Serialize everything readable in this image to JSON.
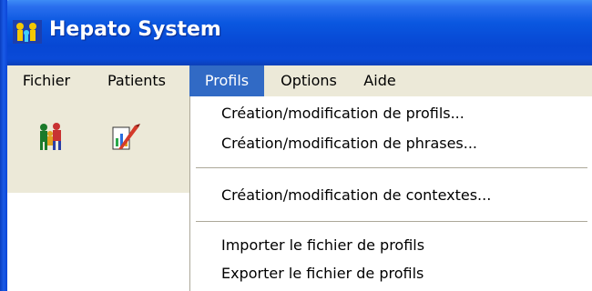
{
  "window": {
    "title": "Hepato System"
  },
  "menubar": {
    "items": [
      {
        "label": "Fichier"
      },
      {
        "label": "Patients"
      },
      {
        "label": "Profils"
      },
      {
        "label": "Options"
      },
      {
        "label": "Aide"
      }
    ],
    "active_item": "Profils"
  },
  "toolbar": {
    "icons": [
      "patients-group-icon",
      "edit-chart-icon"
    ]
  },
  "dropdown": {
    "items": [
      {
        "label": "Création/modification de profils..."
      },
      {
        "label": "Création/modification de phrases..."
      },
      {
        "label": "Création/modification de contextes..."
      },
      {
        "label": "Importer le fichier de profils"
      },
      {
        "label": "Exporter le fichier de profils"
      }
    ]
  },
  "colors": {
    "titlebar": "#0a57e0",
    "menu_highlight": "#316ac5",
    "menubar_bg": "#ece9d8"
  }
}
